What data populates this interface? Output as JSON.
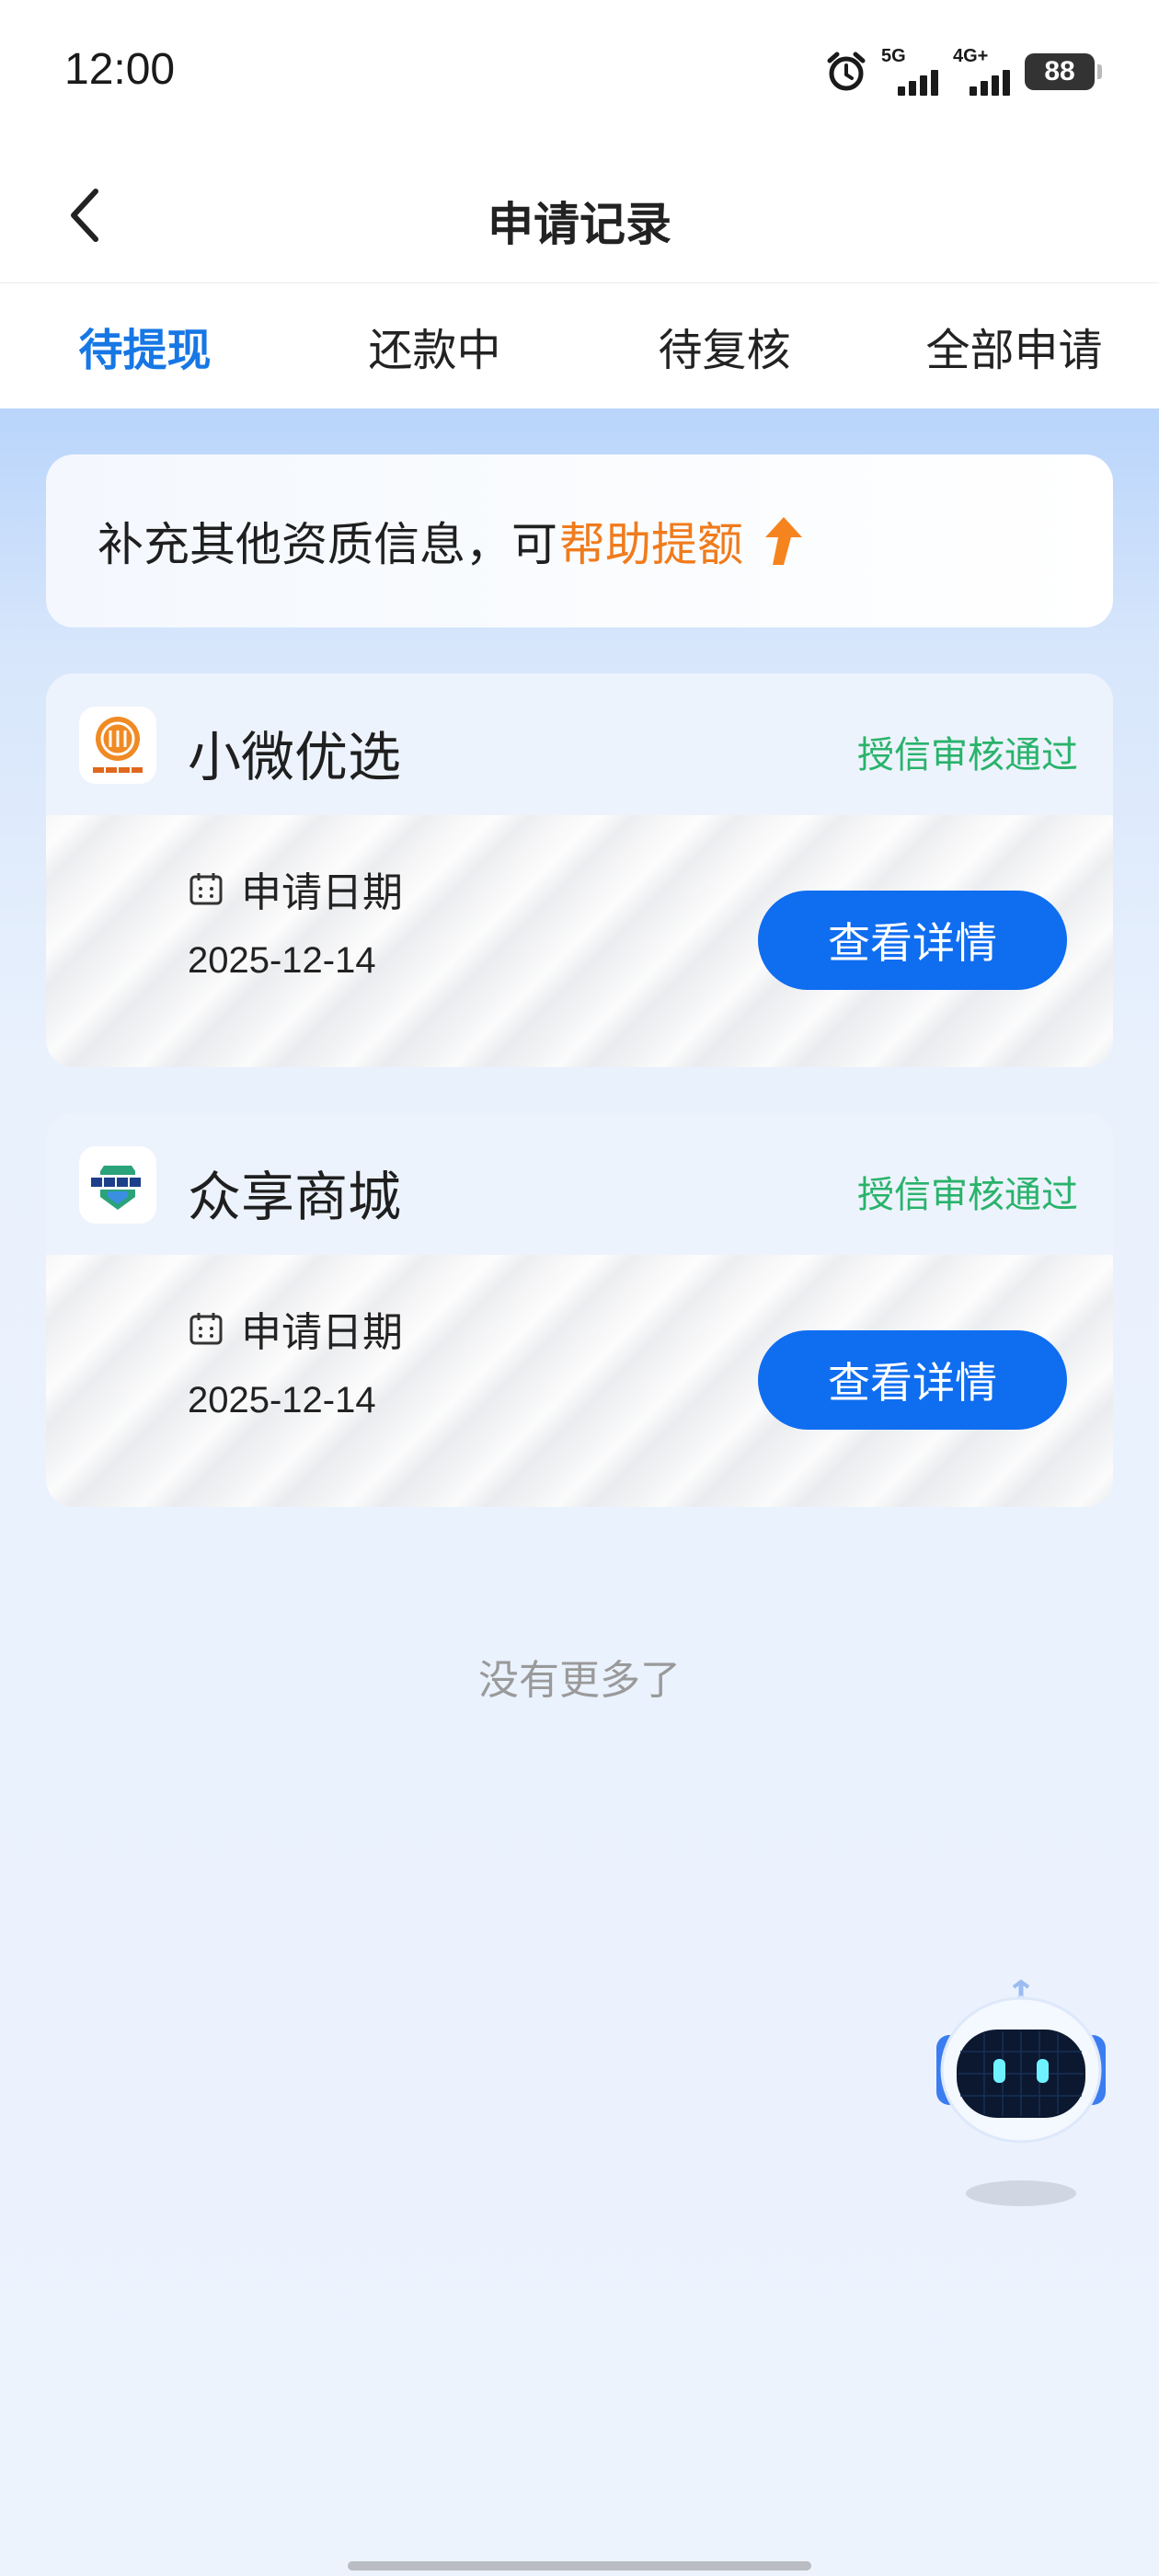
{
  "status_bar": {
    "time": "12:00",
    "signal1_label": "5G",
    "signal2_label": "4G+",
    "battery": "88"
  },
  "header": {
    "title": "申请记录"
  },
  "tabs": [
    {
      "label": "待提现",
      "active": true
    },
    {
      "label": "还款中",
      "active": false
    },
    {
      "label": "待复核",
      "active": false
    },
    {
      "label": "全部申请",
      "active": false
    }
  ],
  "promo": {
    "text": "补充其他资质信息，可",
    "highlight": "帮助提额"
  },
  "applications": [
    {
      "name": "小微优选",
      "status": "授信审核通过",
      "date_label": "申请日期",
      "date": "2025-12-14",
      "button_label": "查看详情",
      "logo_icon": "xiaowei-logo"
    },
    {
      "name": "众享商城",
      "status": "授信审核通过",
      "date_label": "申请日期",
      "date": "2025-12-14",
      "button_label": "查看详情",
      "logo_icon": "zhongxiang-logo"
    }
  ],
  "footer": {
    "no_more": "没有更多了"
  },
  "colors": {
    "accent": "#1677e5",
    "button": "#0f6df0",
    "status_green": "#29b36b",
    "highlight_orange": "#f07b1c"
  }
}
